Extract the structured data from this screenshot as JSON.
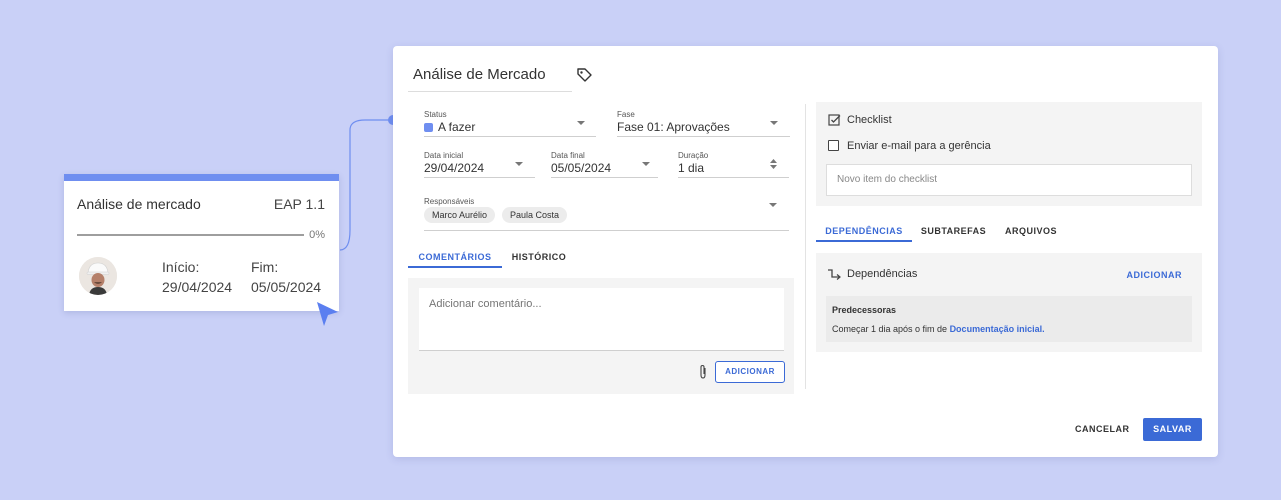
{
  "colors": {
    "accent": "#3b6ad6",
    "card_bar": "#6f8ef0",
    "background": "#c9d0f7"
  },
  "card": {
    "title": "Análise de mercado",
    "code": "EAP 1.1",
    "progress_label": "0%",
    "progress_value": 0,
    "start_label": "Início:",
    "start_value": "29/04/2024",
    "end_label": "Fim:",
    "end_value": "05/05/2024",
    "avatar_icon": "worker-avatar"
  },
  "modal": {
    "title": "Análise de Mercado",
    "status": {
      "label": "Status",
      "value": "A fazer"
    },
    "phase": {
      "label": "Fase",
      "value": "Fase 01: Aprovações"
    },
    "start_date": {
      "label": "Data inicial",
      "value": "29/04/2024"
    },
    "end_date": {
      "label": "Data final",
      "value": "05/05/2024"
    },
    "duration": {
      "label": "Duração",
      "value": "1 dia"
    },
    "responsibles": {
      "label": "Responsáveis",
      "people": [
        "Marco Aurélio",
        "Paula Costa"
      ]
    },
    "left_tabs": [
      "COMENTÁRIOS",
      "HISTÓRICO"
    ],
    "comment": {
      "placeholder": "Adicionar comentário...",
      "add_label": "ADICIONAR"
    },
    "checklist": {
      "title": "Checklist",
      "items": [
        "Enviar e-mail para a gerência"
      ],
      "input_placeholder": "Novo item do checklist"
    },
    "right_tabs": [
      "DEPENDÊNCIAS",
      "SUBTAREFAS",
      "ARQUIVOS"
    ],
    "dependencies": {
      "title": "Dependências",
      "add_label": "ADICIONAR",
      "predecessors_title": "Predecessoras",
      "predecessor_text": "Começar 1 dia após o fim de ",
      "predecessor_link": "Documentação inicial."
    },
    "cancel_label": "CANCELAR",
    "save_label": "SALVAR"
  }
}
